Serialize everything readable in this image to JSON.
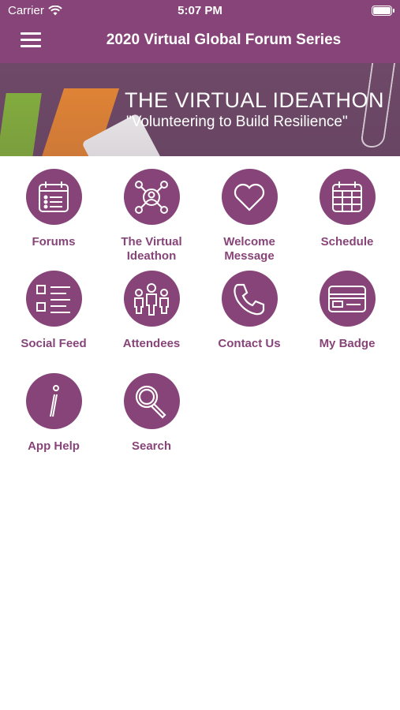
{
  "status_bar": {
    "carrier": "Carrier",
    "time": "5:07 PM"
  },
  "header": {
    "title": "2020 Virtual Global Forum Series",
    "menu_icon": "hamburger-menu-icon"
  },
  "banner": {
    "headline": "THE VIRTUAL IDEATHON",
    "tagline": "\"Volunteering to Build Resilience\""
  },
  "tiles": [
    {
      "label": "Forums",
      "icon": "calendar-list-icon"
    },
    {
      "label": "The Virtual Ideathon",
      "icon": "network-person-icon"
    },
    {
      "label": "Welcome Message",
      "icon": "heart-icon"
    },
    {
      "label": "Schedule",
      "icon": "calendar-grid-icon"
    },
    {
      "label": "Social Feed",
      "icon": "checklist-icon"
    },
    {
      "label": "Attendees",
      "icon": "people-icon"
    },
    {
      "label": "Contact Us",
      "icon": "phone-icon"
    },
    {
      "label": "My Badge",
      "icon": "badge-card-icon"
    },
    {
      "label": "App Help",
      "icon": "info-icon"
    },
    {
      "label": "Search",
      "icon": "search-icon"
    }
  ],
  "colors": {
    "brand": "#874478",
    "banner": "#6e4a68",
    "background": "#ffffff"
  }
}
